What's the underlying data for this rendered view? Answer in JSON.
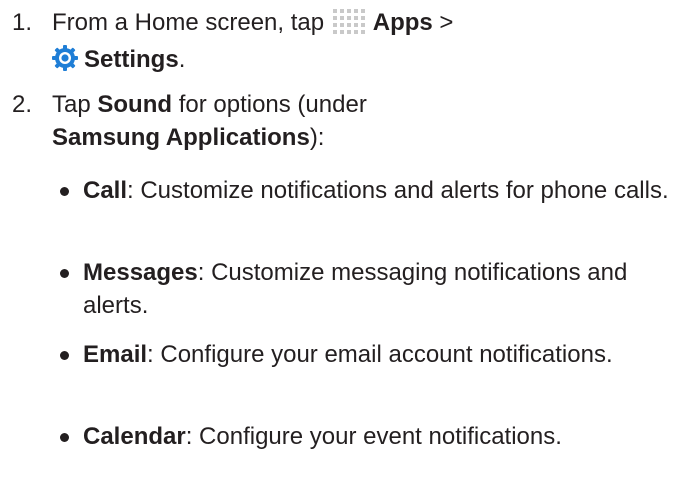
{
  "steps": [
    {
      "number": "1.",
      "line1_prefix": "From a Home screen, tap ",
      "apps_label": "Apps",
      "separator": " >",
      "settings_label": "Settings",
      "end": "."
    },
    {
      "number": "2.",
      "tap": "Tap ",
      "sound_label": "Sound",
      "for_options": " for options (under",
      "section_label": "Samsung Applications",
      "close": "):"
    }
  ],
  "bullets": [
    {
      "term": "Call",
      "desc": ": Customize notifications and alerts for phone calls."
    },
    {
      "term": "Messages",
      "desc": ": Customize messaging notifications and alerts."
    },
    {
      "term": "Email",
      "desc": ": Configure your email account notifications."
    },
    {
      "term": "Calendar",
      "desc": ": Configure your event notifications."
    }
  ],
  "icons": {
    "apps": "apps-grid-icon",
    "settings": "settings-gear-icon"
  },
  "colors": {
    "text": "#231f20",
    "apps_icon": "#c9c9c9",
    "settings_icon": "#1f7ed6"
  }
}
